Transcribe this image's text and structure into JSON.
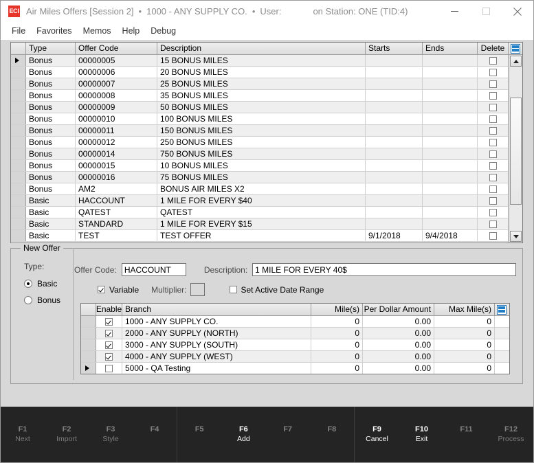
{
  "window": {
    "logo_text": "ECI",
    "title": "Air Miles Offers [Session 2]",
    "separator": "•",
    "company": "1000 - ANY SUPPLY CO.",
    "user_label": "User:",
    "station": "on Station: ONE (TID:4)",
    "minimize_name": "minimize-icon",
    "maximize_name": "maximize-icon",
    "close_name": "close-icon"
  },
  "menubar": {
    "items": [
      {
        "label": "File"
      },
      {
        "label": "Favorites"
      },
      {
        "label": "Memos"
      },
      {
        "label": "Help"
      },
      {
        "label": "Debug"
      }
    ]
  },
  "offers_grid": {
    "columns": [
      "Type",
      "Offer Code",
      "Description",
      "Starts",
      "Ends",
      "Delete"
    ],
    "selected_row_index": 0,
    "rows": [
      {
        "type": "Bonus",
        "code": "00000005",
        "description": "15 BONUS MILES",
        "starts": "",
        "ends": "",
        "delete": false
      },
      {
        "type": "Bonus",
        "code": "00000006",
        "description": "20 BONUS MILES",
        "starts": "",
        "ends": "",
        "delete": false
      },
      {
        "type": "Bonus",
        "code": "00000007",
        "description": "25 BONUS MILES",
        "starts": "",
        "ends": "",
        "delete": false
      },
      {
        "type": "Bonus",
        "code": "00000008",
        "description": "35 BONUS MILES",
        "starts": "",
        "ends": "",
        "delete": false
      },
      {
        "type": "Bonus",
        "code": "00000009",
        "description": "50 BONUS MILES",
        "starts": "",
        "ends": "",
        "delete": false
      },
      {
        "type": "Bonus",
        "code": "00000010",
        "description": "100 BONUS MILES",
        "starts": "",
        "ends": "",
        "delete": false
      },
      {
        "type": "Bonus",
        "code": "00000011",
        "description": "150 BONUS MILES",
        "starts": "",
        "ends": "",
        "delete": false
      },
      {
        "type": "Bonus",
        "code": "00000012",
        "description": "250 BONUS MILES",
        "starts": "",
        "ends": "",
        "delete": false
      },
      {
        "type": "Bonus",
        "code": "00000014",
        "description": "750 BONUS MILES",
        "starts": "",
        "ends": "",
        "delete": false
      },
      {
        "type": "Bonus",
        "code": "00000015",
        "description": "10 BONUS MILES",
        "starts": "",
        "ends": "",
        "delete": false
      },
      {
        "type": "Bonus",
        "code": "00000016",
        "description": "75 BONUS MILES",
        "starts": "",
        "ends": "",
        "delete": false
      },
      {
        "type": "Bonus",
        "code": "AM2",
        "description": "BONUS AIR MILES X2",
        "starts": "",
        "ends": "",
        "delete": false
      },
      {
        "type": "Basic",
        "code": "HACCOUNT",
        "description": "1 MILE FOR EVERY $40",
        "starts": "",
        "ends": "",
        "delete": false
      },
      {
        "type": "Basic",
        "code": "QATEST",
        "description": "QATEST",
        "starts": "",
        "ends": "",
        "delete": false
      },
      {
        "type": "Basic",
        "code": "STANDARD",
        "description": "1 MILE FOR EVERY $15",
        "starts": "",
        "ends": "",
        "delete": false
      },
      {
        "type": "Basic",
        "code": "TEST",
        "description": "TEST OFFER",
        "starts": "9/1/2018",
        "ends": "9/4/2018",
        "delete": false
      }
    ]
  },
  "new_offer": {
    "group_title": "New Offer",
    "type_label": "Type:",
    "type_options": [
      {
        "label": "Basic",
        "selected": true
      },
      {
        "label": "Bonus",
        "selected": false
      }
    ],
    "offer_code_label": "Offer Code:",
    "offer_code_value": "HACCOUNT",
    "description_label": "Description:",
    "description_value": "1 MILE FOR EVERY 40$",
    "variable_label": "Variable",
    "variable_checked": true,
    "multiplier_label": "Multiplier:",
    "multiplier_value": "",
    "date_range_label": "Set Active Date Range",
    "date_range_checked": false
  },
  "branch_grid": {
    "columns": [
      "Enable",
      "Branch",
      "Mile(s)",
      "Per Dollar Amount",
      "Max Mile(s)"
    ],
    "selected_row_index": 4,
    "rows": [
      {
        "enable": true,
        "branch": "1000 - ANY SUPPLY CO.",
        "miles": "0",
        "per_dollar": "0.00",
        "max_miles": "0"
      },
      {
        "enable": true,
        "branch": "2000 - ANY SUPPLY (NORTH)",
        "miles": "0",
        "per_dollar": "0.00",
        "max_miles": "0"
      },
      {
        "enable": true,
        "branch": "3000 - ANY SUPPLY (SOUTH)",
        "miles": "0",
        "per_dollar": "0.00",
        "max_miles": "0"
      },
      {
        "enable": true,
        "branch": "4000 - ANY SUPPLY (WEST)",
        "miles": "0",
        "per_dollar": "0.00",
        "max_miles": "0"
      },
      {
        "enable": false,
        "branch": "5000 - QA Testing",
        "miles": "0",
        "per_dollar": "0.00",
        "max_miles": "0"
      }
    ]
  },
  "function_keys": {
    "group1": [
      {
        "key": "F1",
        "name": "Next",
        "active": false
      },
      {
        "key": "F2",
        "name": "Import",
        "active": false
      },
      {
        "key": "F3",
        "name": "Style",
        "active": false
      },
      {
        "key": "F4",
        "name": "",
        "active": false
      }
    ],
    "group2": [
      {
        "key": "F5",
        "name": "",
        "active": false
      },
      {
        "key": "F6",
        "name": "Add",
        "active": true
      },
      {
        "key": "F7",
        "name": "",
        "active": false
      },
      {
        "key": "F8",
        "name": "",
        "active": false
      }
    ],
    "group3": [
      {
        "key": "F9",
        "name": "Cancel",
        "active": true
      },
      {
        "key": "F10",
        "name": "Exit",
        "active": true
      },
      {
        "key": "F11",
        "name": "",
        "active": false
      },
      {
        "key": "F12",
        "name": "Process",
        "active": false
      }
    ]
  },
  "colors": {
    "accent_red": "#e8352b",
    "grid_icon_blue": "#1f7ec6",
    "fkey_bar": "#242424",
    "window_bg": "#d8d8d8"
  }
}
